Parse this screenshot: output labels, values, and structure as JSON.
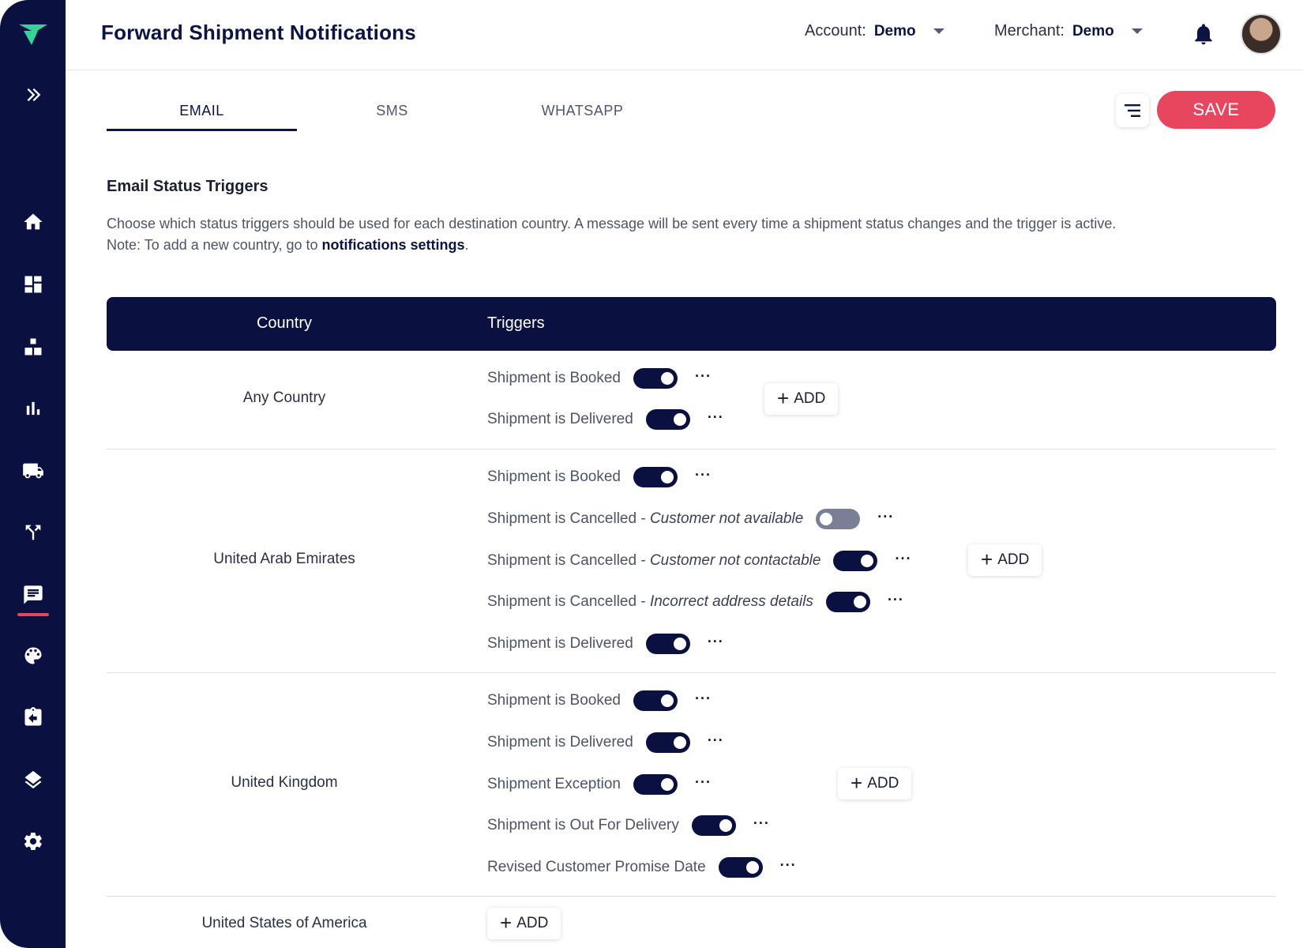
{
  "header": {
    "title": "Forward Shipment Notifications",
    "account_label": "Account:",
    "account_value": "Demo",
    "merchant_label": "Merchant:",
    "merchant_value": "Demo"
  },
  "sidebar": {
    "items": [
      "expand",
      "home",
      "dashboard",
      "structure",
      "analytics",
      "shipping",
      "routing",
      "notifications",
      "themes",
      "returns",
      "layers",
      "settings"
    ],
    "active": "notifications"
  },
  "tabs": [
    {
      "label": "EMAIL",
      "active": true
    },
    {
      "label": "SMS",
      "active": false
    },
    {
      "label": "WHATSAPP",
      "active": false
    }
  ],
  "actions": {
    "save_label": "SAVE"
  },
  "section": {
    "title": "Email Status Triggers",
    "description_line1": "Choose which status triggers should be used for each destination country. A message will be sent every time a shipment status changes and the trigger is active.",
    "description_note_prefix": "Note: To add a new country, go to ",
    "description_link": "notifications settings",
    "description_note_suffix": "."
  },
  "table": {
    "col_country": "Country",
    "col_triggers": "Triggers",
    "add_label": "ADD",
    "rows": [
      {
        "country": "Any Country",
        "triggers": [
          {
            "label": "Shipment is Booked",
            "reason": "",
            "enabled": true
          },
          {
            "label": "Shipment is Delivered",
            "reason": "",
            "enabled": true
          }
        ]
      },
      {
        "country": "United Arab Emirates",
        "triggers": [
          {
            "label": "Shipment is Booked",
            "reason": "",
            "enabled": true
          },
          {
            "label": "Shipment is Cancelled - ",
            "reason": "Customer not available",
            "enabled": false
          },
          {
            "label": "Shipment is Cancelled - ",
            "reason": "Customer not contactable",
            "enabled": true
          },
          {
            "label": "Shipment is Cancelled - ",
            "reason": "Incorrect address details",
            "enabled": true
          },
          {
            "label": "Shipment is Delivered",
            "reason": "",
            "enabled": true
          }
        ]
      },
      {
        "country": "United Kingdom",
        "triggers": [
          {
            "label": "Shipment is Booked",
            "reason": "",
            "enabled": true
          },
          {
            "label": "Shipment is Delivered",
            "reason": "",
            "enabled": true
          },
          {
            "label": "Shipment Exception",
            "reason": "",
            "enabled": true
          },
          {
            "label": "Shipment is Out For Delivery",
            "reason": "",
            "enabled": true
          },
          {
            "label": "Revised Customer Promise Date",
            "reason": "",
            "enabled": true
          }
        ]
      },
      {
        "country": "United States of America",
        "triggers": []
      }
    ]
  },
  "colors": {
    "navy": "#0a1140",
    "accent": "#e8455f",
    "toggle_off": "#7b7f96"
  }
}
